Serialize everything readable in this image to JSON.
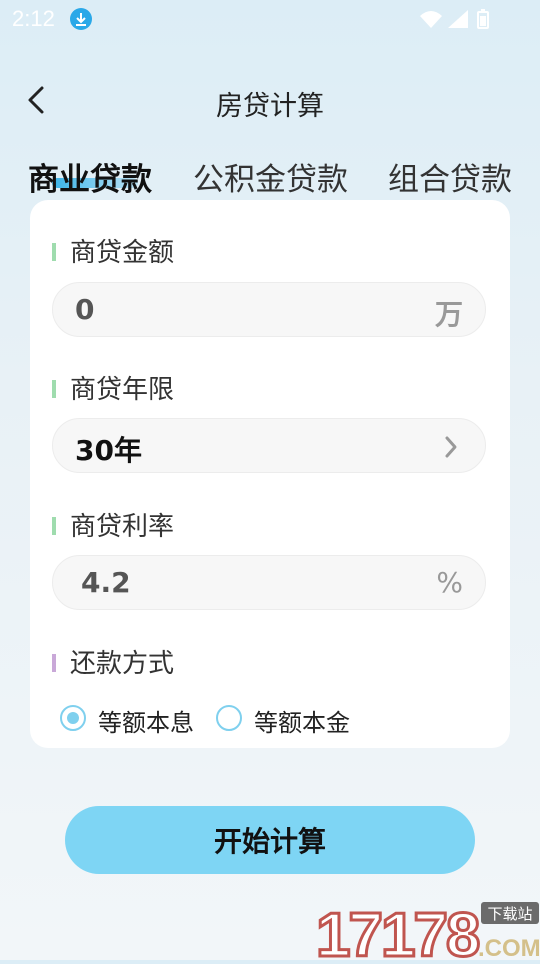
{
  "status_bar": {
    "time": "2:12"
  },
  "nav": {
    "title": "房贷计算"
  },
  "tabs": [
    {
      "label": "商业贷款"
    },
    {
      "label": "公积金贷款"
    },
    {
      "label": "组合贷款"
    }
  ],
  "form": {
    "amount": {
      "label": "商贷金额",
      "value": "0",
      "unit": "万"
    },
    "term": {
      "label": "商贷年限",
      "value": "30年"
    },
    "rate": {
      "label": "商贷利率",
      "value": "4.2",
      "unit": "%"
    },
    "repayment": {
      "label": "还款方式",
      "options": [
        "等额本息",
        "等额本金"
      ],
      "selected_index": 0
    }
  },
  "actions": {
    "calculate_label": "开始计算"
  },
  "colors": {
    "accent": "#7ed5f4",
    "label_bar_green": "#9fdcae",
    "label_bar_purple": "#c9a8d8"
  },
  "watermark": {
    "main": "17178",
    "tag": "下载站",
    "suffix": ".COM"
  }
}
